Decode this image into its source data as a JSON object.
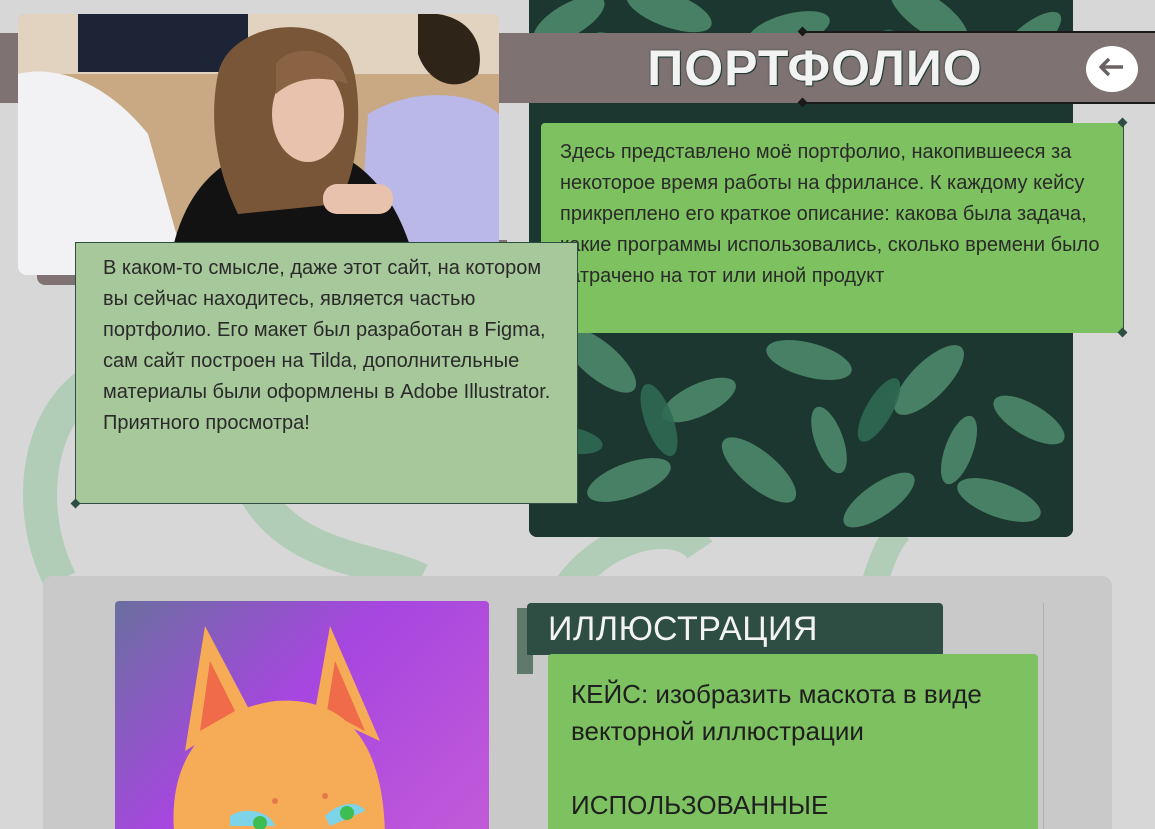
{
  "header": {
    "title": "ПОРТФОЛИО",
    "back_icon": "arrow-left-icon"
  },
  "intro": {
    "text": "Здесь представлено моё портфолио, накопившееся за некоторое время работы на фрилансе. К каждому кейсу прикреплено его краткое описание: какова была задача, какие программы использовались, сколько времени было затрачено на тот или иной продукт"
  },
  "about": {
    "text": "В каком-то смысле, даже этот сайт, на котором вы сейчас находитесь, является частью портфолио. Его макет был разработан в Figma, сам сайт построен на Tilda, дополнительные материалы были оформлены в Adobe Illustrator.\nПриятного просмотра!"
  },
  "case": {
    "title": "ИЛЛЮСТРАЦИЯ",
    "task_label": "КЕЙС:",
    "task_text": "изобразить маскота в виде векторной иллюстрации",
    "tools_label": "ИСПОЛЬЗОВАННЫЕ"
  },
  "colors": {
    "header_bar": "#7f7272",
    "card_green": "#7dc160",
    "card_light_green": "#a7c89a",
    "dark_green": "#2e4d43",
    "background": "#d7d7d7"
  }
}
